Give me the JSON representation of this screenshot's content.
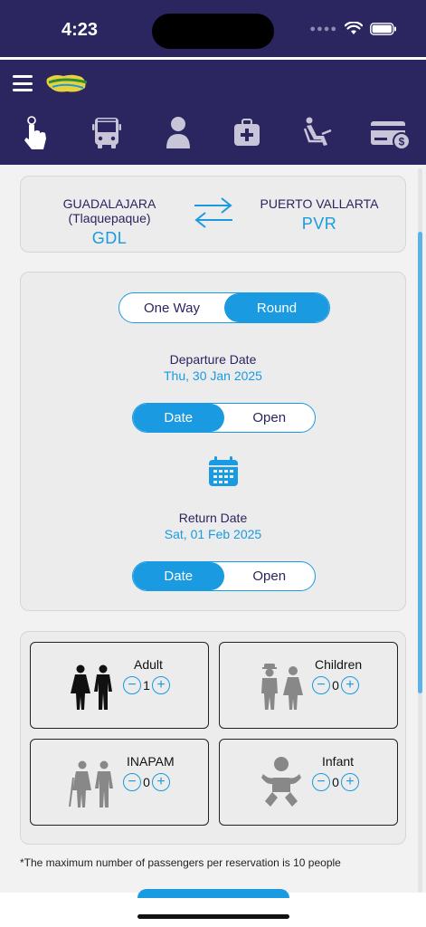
{
  "status_bar": {
    "time": "4:23"
  },
  "route": {
    "origin_name": "GUADALAJARA (Tlaquepaque)",
    "origin_code": "GDL",
    "destination_name": "PUERTO VALLARTA",
    "destination_code": "PVR"
  },
  "trip_type": {
    "one_way": "One Way",
    "round": "Round",
    "selected": "Round"
  },
  "departure": {
    "label": "Departure Date",
    "date": "Thu, 30 Jan 2025",
    "mode_date": "Date",
    "mode_open": "Open",
    "selected": "Date"
  },
  "return": {
    "label": "Return Date",
    "date": "Sat, 01 Feb 2025",
    "mode_date": "Date",
    "mode_open": "Open",
    "selected": "Date"
  },
  "passengers": {
    "adult": {
      "label": "Adult",
      "count": "1"
    },
    "children": {
      "label": "Children",
      "count": "0"
    },
    "inapam": {
      "label": "INAPAM",
      "count": "0"
    },
    "infant": {
      "label": "Infant",
      "count": "0"
    },
    "minus": "−",
    "plus": "+"
  },
  "note": "*The maximum number of passengers per reservation is 10 people",
  "colors": {
    "header": "#2b2560",
    "accent": "#1a9ae0",
    "text": "#2a2560"
  },
  "nav_icons": [
    "touch-icon",
    "bus-icon",
    "user-icon",
    "medical-icon",
    "seat-icon",
    "payment-icon"
  ]
}
